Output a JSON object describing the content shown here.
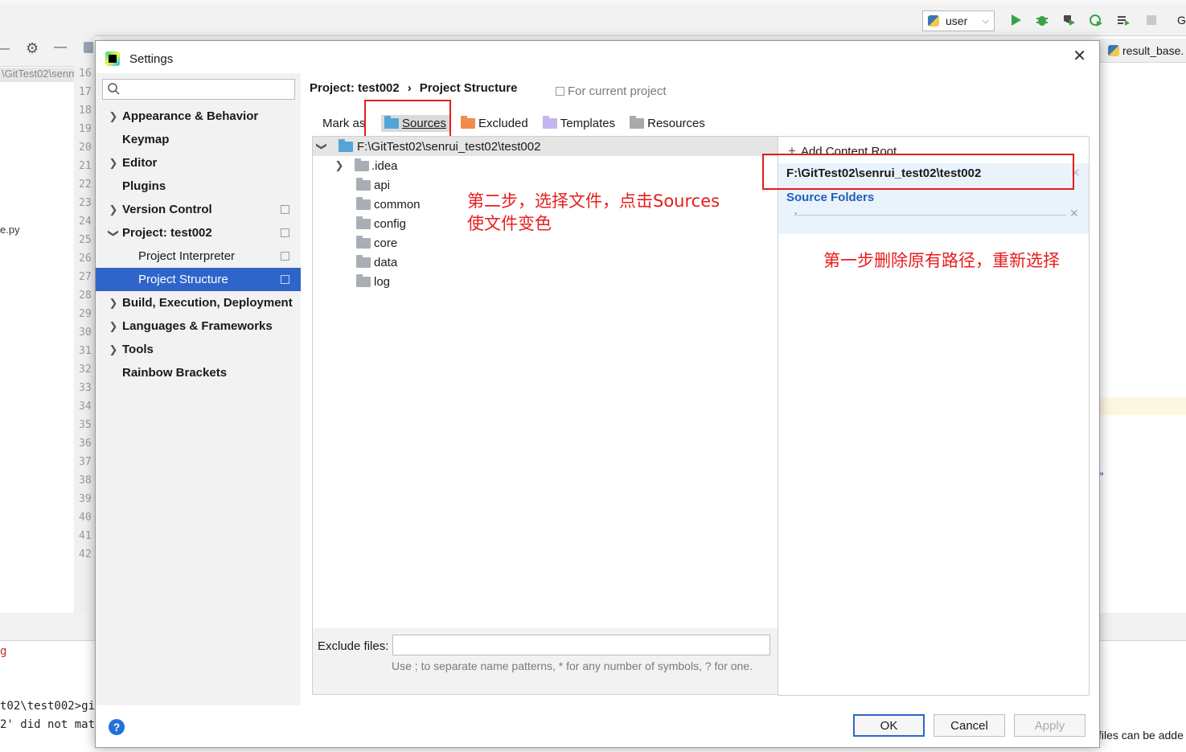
{
  "ide": {
    "run_config": "user",
    "gutter_lines": [
      "16",
      "17",
      "18",
      "19",
      "20",
      "21",
      "22",
      "23",
      "24",
      "25",
      "26",
      "27",
      "28",
      "29",
      "30",
      "31",
      "32",
      "33",
      "34",
      "35",
      "36",
      "37",
      "38",
      "39",
      "40",
      "41",
      "42"
    ],
    "project_path": "\\GitTest02\\senru",
    "left_file": "e.py",
    "right_tab": "result_base.",
    "right_edge_char": "G",
    "terminal_line1": "t02\\test002>gi",
    "terminal_line2": "2' did not mat",
    "terminal_red": "g",
    "bottom_right_text": "files can be adde",
    "right_quote": "\""
  },
  "dialog": {
    "title": "Settings",
    "search_placeholder": "",
    "nav": [
      {
        "label": "Appearance & Behavior",
        "expandable": true,
        "expanded": false
      },
      {
        "label": "Keymap",
        "expandable": false
      },
      {
        "label": "Editor",
        "expandable": true,
        "expanded": false
      },
      {
        "label": "Plugins",
        "expandable": false
      },
      {
        "label": "Version Control",
        "expandable": true,
        "expanded": false
      },
      {
        "label": "Project: test002",
        "expandable": true,
        "expanded": true
      },
      {
        "label": "Project Interpreter",
        "child": true
      },
      {
        "label": "Project Structure",
        "child": true,
        "selected": true
      },
      {
        "label": "Build, Execution, Deployment",
        "expandable": true,
        "expanded": false
      },
      {
        "label": "Languages & Frameworks",
        "expandable": true,
        "expanded": false
      },
      {
        "label": "Tools",
        "expandable": true,
        "expanded": false
      },
      {
        "label": "Rainbow Brackets",
        "expandable": false
      }
    ],
    "breadcrumb": {
      "project": "Project: test002",
      "separator": "›",
      "page": "Project Structure"
    },
    "for_current_project": "For current project",
    "mark_as": {
      "label": "Mark as:",
      "buttons": [
        {
          "label": "Sources",
          "color": "#55a4d9"
        },
        {
          "label": "Excluded",
          "color": "#f28b4c"
        },
        {
          "label": "Templates",
          "color": "#c4b4ef"
        },
        {
          "label": "Resources",
          "color": "#a9a9a9"
        }
      ]
    },
    "tree": {
      "root": "F:\\GitTest02\\senrui_test02\\test002",
      "children": [
        ".idea",
        "api",
        "common",
        "config",
        "core",
        "data",
        "log"
      ]
    },
    "exclude_files": {
      "label": "Exclude files:",
      "value": "",
      "hint": "Use ; to separate name patterns, * for any number of symbols, ? for one."
    },
    "content_root": {
      "add_label": "Add Content Root",
      "path": "F:\\GitTest02\\senrui_test02\\test002",
      "source_folders_label": "Source Folders",
      "source_folder_item": "."
    },
    "buttons": {
      "ok": "OK",
      "cancel": "Cancel",
      "apply": "Apply"
    },
    "help": "?"
  },
  "annotations": {
    "step2_line1": "第二步，选择文件，点击Sources",
    "step2_line2": "使文件变色",
    "step1": "第一步删除原有路径，重新选择"
  },
  "colors": {
    "accent": "#2f65ca",
    "annotation_red": "#e81c1c",
    "source_blue": "#1f5fb8"
  }
}
